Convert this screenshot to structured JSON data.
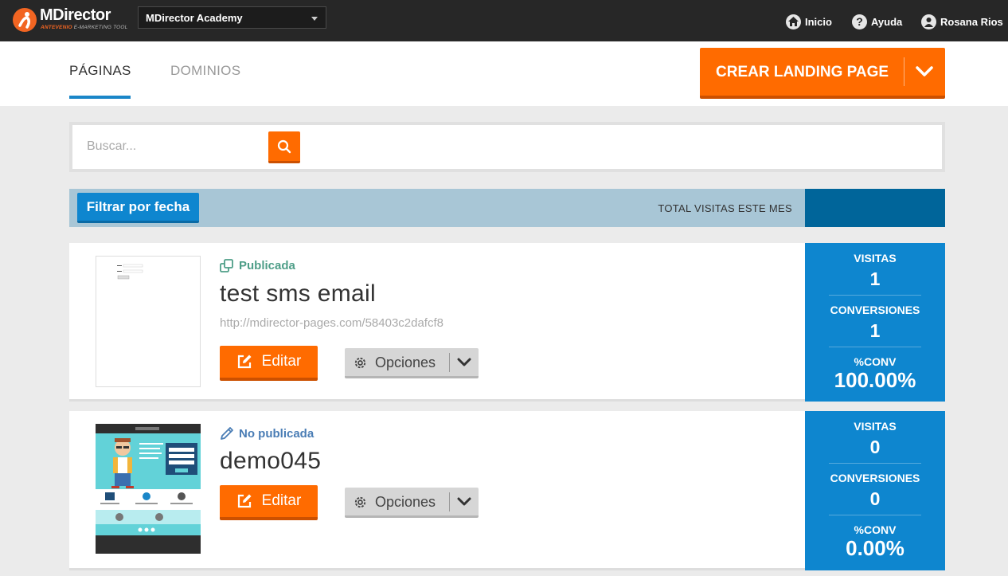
{
  "brand": {
    "name": "MDirector",
    "sub_brand": "ANTEVENIO",
    "sub_tagline": "E-MARKETING TOOL",
    "accent": "#ff6b00",
    "blue": "#0e86cf"
  },
  "account": {
    "selected": "MDirector Academy"
  },
  "topnav": {
    "home": "Inicio",
    "help": "Ayuda",
    "user": "Rosana Rios"
  },
  "tabs": [
    {
      "label": "PÁGINAS",
      "active": true
    },
    {
      "label": "DOMINIOS",
      "active": false
    }
  ],
  "create_button": {
    "label": "CREAR LANDING PAGE"
  },
  "search": {
    "placeholder": "Buscar...",
    "value": ""
  },
  "filter": {
    "button": "Filtrar por fecha",
    "total_label": "TOTAL VISITAS ESTE MES"
  },
  "pages": [
    {
      "status": "Publicada",
      "status_icon": "copy-icon",
      "title": "test sms email",
      "url": "http://mdirector-pages.com/58403c2dafcf8",
      "edit_label": "Editar",
      "options_label": "Opciones",
      "stats": {
        "visits_label": "VISITAS",
        "visits": "1",
        "conversions_label": "CONVERSIONES",
        "conversions": "1",
        "conv_rate_label": "%CONV",
        "conv_rate": "100.00%"
      }
    },
    {
      "status": "No publicada",
      "status_icon": "pencil-icon",
      "title": "demo045",
      "url": "",
      "edit_label": "Editar",
      "options_label": "Opciones",
      "stats": {
        "visits_label": "VISITAS",
        "visits": "0",
        "conversions_label": "CONVERSIONES",
        "conversions": "0",
        "conv_rate_label": "%CONV",
        "conv_rate": "0.00%"
      }
    }
  ]
}
